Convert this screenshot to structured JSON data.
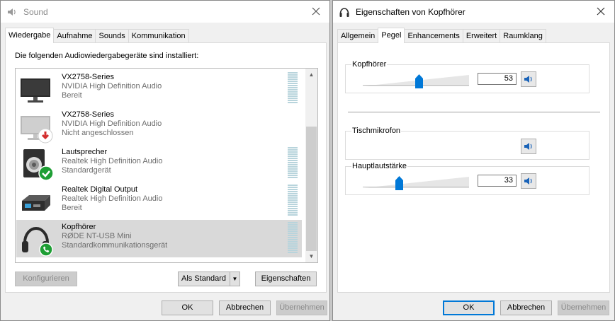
{
  "sound": {
    "title": "Sound",
    "tabs": [
      {
        "label": "Wiedergabe",
        "active": true
      },
      {
        "label": "Aufnahme"
      },
      {
        "label": "Sounds"
      },
      {
        "label": "Kommunikation"
      }
    ],
    "intro": "Die folgenden Audiowiedergabegeräte sind installiert:",
    "devices": [
      {
        "name": "VX2758-Series",
        "driver": "NVIDIA High Definition Audio",
        "status": "Bereit",
        "icon": "monitor-icon"
      },
      {
        "name": "VX2758-Series",
        "driver": "NVIDIA High Definition Audio",
        "status": "Nicht angeschlossen",
        "icon": "monitor-disconnected-icon"
      },
      {
        "name": "Lautsprecher",
        "driver": "Realtek High Definition Audio",
        "status": "Standardgerät",
        "icon": "speaker-icon"
      },
      {
        "name": "Realtek Digital Output",
        "driver": "Realtek High Definition Audio",
        "status": "Bereit",
        "icon": "digital-output-icon"
      },
      {
        "name": "Kopfhörer",
        "driver": "RØDE NT-USB Mini",
        "status": "Standardkommunikationsgerät",
        "icon": "headphones-icon",
        "selected": true
      }
    ],
    "buttons": {
      "configure": "Konfigurieren",
      "set_default": "Als Standard",
      "properties": "Eigenschaften",
      "ok": "OK",
      "cancel": "Abbrechen",
      "apply": "Übernehmen"
    }
  },
  "props": {
    "title": "Eigenschaften von Kopfhörer",
    "tabs": [
      {
        "label": "Allgemein"
      },
      {
        "label": "Pegel",
        "active": true
      },
      {
        "label": "Enhancements"
      },
      {
        "label": "Erweitert"
      },
      {
        "label": "Raumklang"
      }
    ],
    "levels": {
      "headphones": {
        "label": "Kopfhörer",
        "value": "53",
        "level": 53
      },
      "mic": {
        "label": "Tischmikrofon"
      },
      "master": {
        "label": "Hauptlautstärke",
        "value": "33",
        "level": 33
      }
    },
    "buttons": {
      "ok": "OK",
      "cancel": "Abbrechen",
      "apply": "Übernehmen"
    }
  },
  "colors": {
    "accent": "#0078d7",
    "selection": "#d9d9d9",
    "meter": "#b8d4dc",
    "default_check": "#1e9e34",
    "disconnected": "#d32f2f"
  }
}
